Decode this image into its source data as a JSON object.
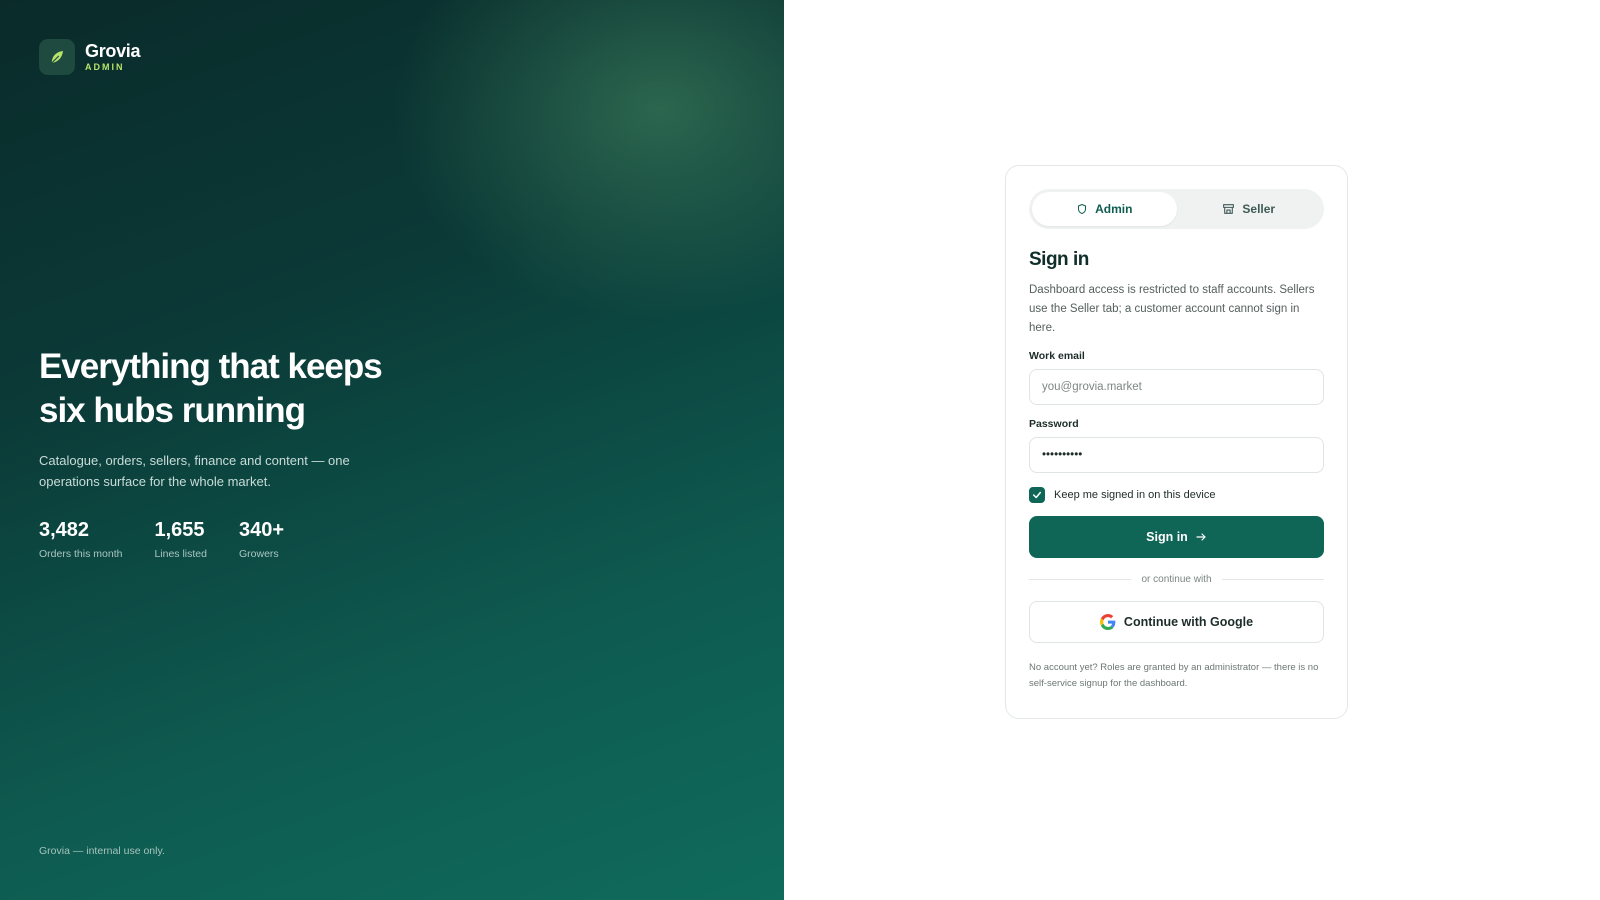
{
  "brand": {
    "name": "Grovia",
    "subtitle": "ADMIN",
    "mark_icon": "leaf-icon",
    "accent_color": "#b6e36a"
  },
  "hero": {
    "title_line1": "Everything that keeps",
    "title_line2": "six hubs running",
    "description": "Catalogue, orders, sellers, finance and content — one operations surface for the whole market.",
    "stats": [
      {
        "value": "3,482",
        "label": "Orders this month"
      },
      {
        "value": "1,655",
        "label": "Lines listed"
      },
      {
        "value": "340+",
        "label": "Growers"
      }
    ],
    "footer": "Grovia — internal use only."
  },
  "auth": {
    "tabs": [
      {
        "label": "Admin",
        "icon": "shield-icon",
        "active": true
      },
      {
        "label": "Seller",
        "icon": "store-icon",
        "active": false
      }
    ],
    "title": "Sign in",
    "description": "Dashboard access is restricted to staff accounts. Sellers use the Seller tab; a customer account cannot sign in here.",
    "email": {
      "label": "Work email",
      "placeholder": "you@grovia.market",
      "value": ""
    },
    "password": {
      "label": "Password",
      "value": "••••••••••"
    },
    "remember": {
      "label": "Keep me signed in on this device",
      "checked": true
    },
    "submit_label": "Sign in",
    "divider_text": "or continue with",
    "google_label": "Continue with Google",
    "footnote": "No account yet? Roles are granted by an administrator — there is no self-service signup for the dashboard."
  },
  "colors": {
    "primary": "#0f6656",
    "hero_dark": "#0a2b2a",
    "hero_light": "#0f6b5c"
  }
}
